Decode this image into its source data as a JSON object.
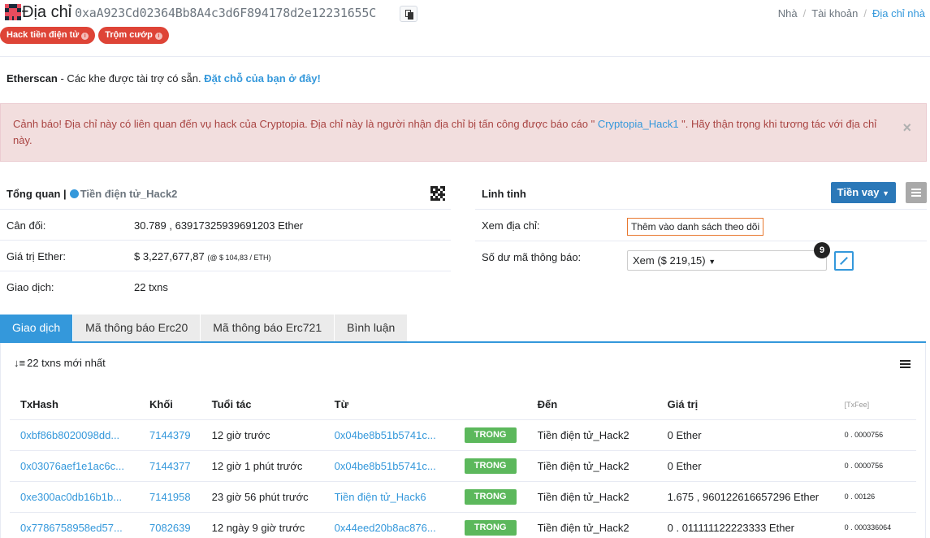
{
  "header": {
    "title": "Địa chỉ",
    "address": "0xaA923Cd02364Bb8A4c3d6F894178d2e12231655C",
    "breadcrumb": [
      "Nhà",
      "Tài khoản",
      "Địa chỉ nhà"
    ],
    "tags": [
      {
        "label": "Hack tiền điện tử"
      },
      {
        "label": "Trộm cướp"
      }
    ]
  },
  "sponsor": {
    "brand": "Etherscan",
    "text": " - Các khe được tài trợ có sẵn. ",
    "link": "Đặt chỗ của bạn ở đây!"
  },
  "warning": {
    "text_before": "Cảnh báo! Địa chỉ này có liên quan đến vụ hack của Cryptopia. Địa chỉ này là người nhận địa chỉ bị tấn công được báo cáo \" ",
    "link": "Cryptopia_Hack1",
    "text_after": " \". Hãy thận trọng khi tương tác với địa chỉ này.",
    "close": "×"
  },
  "overview": {
    "title": "Tổng quan |",
    "label": "Tiền điện tử_Hack2",
    "rows": [
      {
        "key": "Cân đối:",
        "value": "30.789 , 63917325939691203 Ether"
      },
      {
        "key": "Giá trị Ether:",
        "value": "$ 3,227,677,87",
        "note": "(@ $ 104,83 / ETH)"
      },
      {
        "key": "Giao dịch:",
        "value": "22 txns"
      }
    ]
  },
  "misc": {
    "title": "Linh tinh",
    "borrow_label": "Tiền vay",
    "watch_key": "Xem địa chỉ:",
    "watch_button": "Thêm vào danh sách theo dõi",
    "token_key": "Số dư mã thông báo:",
    "token_select": "Xem ($ 219,15)",
    "token_count": "9"
  },
  "tabs": [
    {
      "label": "Giao dịch",
      "active": true
    },
    {
      "label": "Mã thông báo Erc20"
    },
    {
      "label": "Mã thông báo Erc721"
    },
    {
      "label": "Bình luận"
    }
  ],
  "transactions": {
    "count_label": "22 txns mới nhất",
    "columns": [
      "TxHash",
      "Khối",
      "Tuổi tác",
      "Từ",
      "",
      "Đến",
      "Giá trị",
      "[TxFee]"
    ],
    "rows": [
      {
        "hash": "0xbf86b8020098dd...",
        "block": "7144379",
        "age": "12 giờ trước",
        "from": "0x04be8b51b5741c...",
        "dir": "TRONG",
        "to": "Tiền điện tử_Hack2",
        "value": "0 Ether",
        "fee": "0 . 0000756"
      },
      {
        "hash": "0x03076aef1e1ac6c...",
        "block": "7144377",
        "age": "12 giờ 1 phút trước",
        "from": "0x04be8b51b5741c...",
        "dir": "TRONG",
        "to": "Tiền điện tử_Hack2",
        "value": "0 Ether",
        "fee": "0 . 0000756"
      },
      {
        "hash": "0xe300ac0db16b1b...",
        "block": "7141958",
        "age": "23 giờ 56 phút trước",
        "from": "Tiền điện tử_Hack6",
        "dir": "TRONG",
        "to": "Tiền điện tử_Hack2",
        "value": "1.675 , 960122616657296 Ether",
        "fee": "0 . 00126"
      },
      {
        "hash": "0x7786758958ed57...",
        "block": "7082639",
        "age": "12 ngày 9 giờ trước",
        "from": "0x44eed20b8ac876...",
        "dir": "TRONG",
        "to": "Tiền điện tử_Hack2",
        "value": "0 . 011111122223333 Ether",
        "fee": "0 . 000336064"
      }
    ]
  }
}
